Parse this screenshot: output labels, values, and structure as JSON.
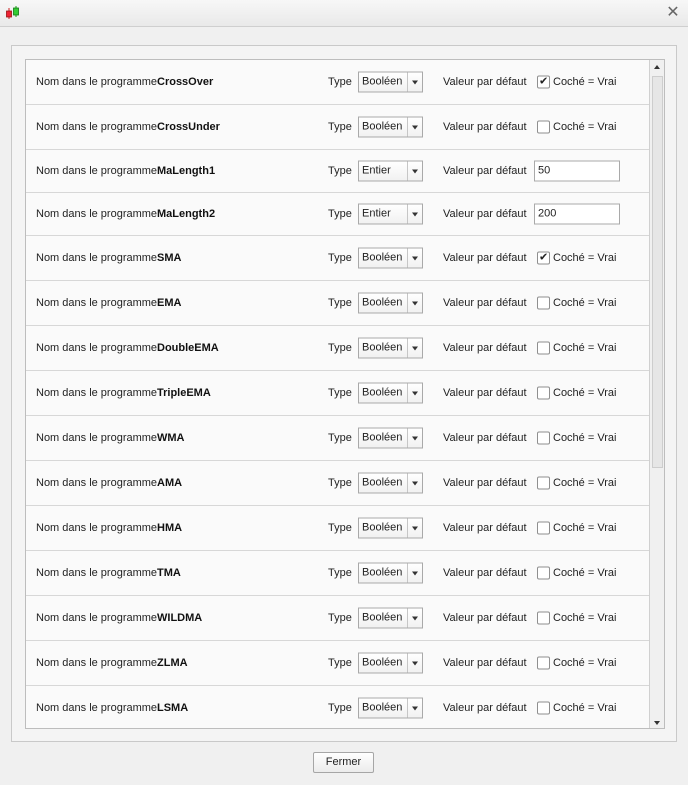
{
  "window": {
    "close_glyph": "✕",
    "icon": "candlestick-chart-icon"
  },
  "labels": {
    "name_label": "Nom dans le programme",
    "type_label": "Type",
    "default_label": "Valeur par défaut",
    "checkbox_label": "Coché = Vrai"
  },
  "rows": [
    {
      "name": "CrossOver",
      "type": "Booléen",
      "kind": "bool",
      "checked": true
    },
    {
      "name": "CrossUnder",
      "type": "Booléen",
      "kind": "bool",
      "checked": false
    },
    {
      "name": "MaLength1",
      "type": "Entier",
      "kind": "int",
      "value": "50"
    },
    {
      "name": "MaLength2",
      "type": "Entier",
      "kind": "int",
      "value": "200"
    },
    {
      "name": "SMA",
      "type": "Booléen",
      "kind": "bool",
      "checked": true
    },
    {
      "name": "EMA",
      "type": "Booléen",
      "kind": "bool",
      "checked": false
    },
    {
      "name": "DoubleEMA",
      "type": "Booléen",
      "kind": "bool",
      "checked": false
    },
    {
      "name": "TripleEMA",
      "type": "Booléen",
      "kind": "bool",
      "checked": false
    },
    {
      "name": "WMA",
      "type": "Booléen",
      "kind": "bool",
      "checked": false
    },
    {
      "name": "AMA",
      "type": "Booléen",
      "kind": "bool",
      "checked": false
    },
    {
      "name": "HMA",
      "type": "Booléen",
      "kind": "bool",
      "checked": false
    },
    {
      "name": "TMA",
      "type": "Booléen",
      "kind": "bool",
      "checked": false
    },
    {
      "name": "WILDMA",
      "type": "Booléen",
      "kind": "bool",
      "checked": false
    },
    {
      "name": "ZLMA",
      "type": "Booléen",
      "kind": "bool",
      "checked": false
    },
    {
      "name": "LSMA",
      "type": "Booléen",
      "kind": "bool",
      "checked": false
    }
  ],
  "footer": {
    "close_button": "Fermer"
  }
}
